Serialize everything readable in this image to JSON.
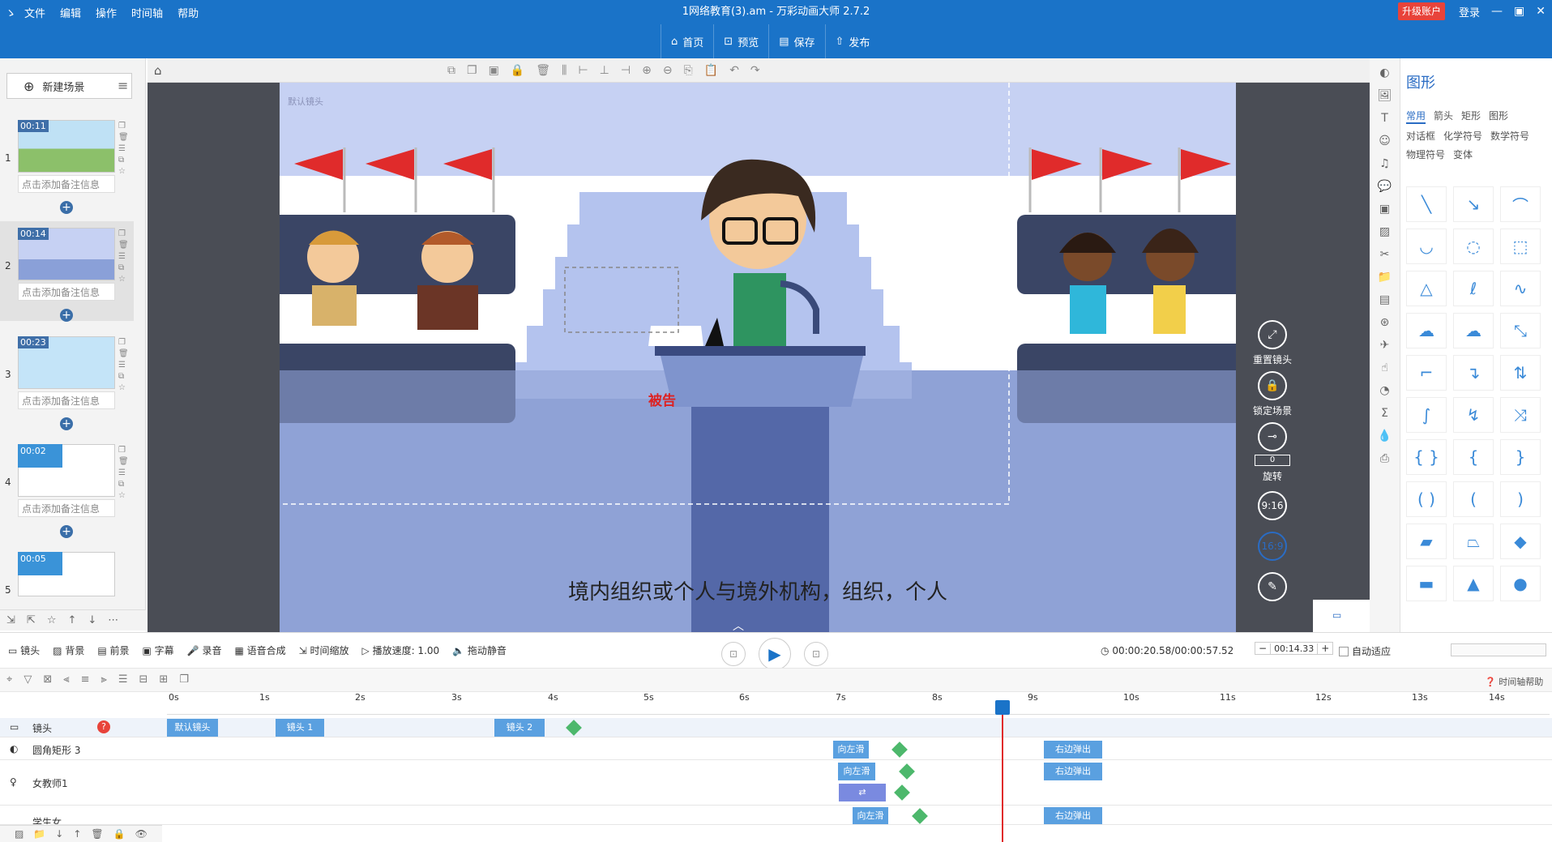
{
  "app": {
    "logo": "ゝ",
    "title": "1网络教育(3).am - 万彩动画大师 2.7.2",
    "upgrade": "升级账户",
    "login": "登录"
  },
  "menu": [
    "文件",
    "编辑",
    "操作",
    "时间轴",
    "帮助"
  ],
  "top_buttons": [
    {
      "label": "首页",
      "icon": "home-icon"
    },
    {
      "label": "预览",
      "icon": "preview-icon"
    },
    {
      "label": "保存",
      "icon": "save-icon"
    },
    {
      "label": "发布",
      "icon": "publish-icon"
    }
  ],
  "left": {
    "new_scene": "新建场景",
    "scenes": [
      {
        "num": "1",
        "time": "00:11",
        "note": "点击添加备注信息"
      },
      {
        "num": "2",
        "time": "00:14",
        "note": "点击添加备注信息"
      },
      {
        "num": "3",
        "time": "00:23",
        "note": "点击添加备注信息"
      },
      {
        "num": "4",
        "time": "00:02",
        "note": "点击添加备注信息"
      },
      {
        "num": "5",
        "time": "00:05",
        "note": ""
      }
    ]
  },
  "canvas": {
    "camera_label": "默认镜头",
    "podium_label": "被告",
    "subtitle": "境内组织或个人与境外机构，组织，个人"
  },
  "side_tools": {
    "reset": "重置镜头",
    "lock": "锁定场景",
    "rotate_value": "0",
    "rotate": "旋转",
    "ratio1": "9:16",
    "ratio2": "16:9"
  },
  "right": {
    "title": "图形",
    "tabs": [
      "常用",
      "箭头",
      "矩形",
      "图形",
      "对话框",
      "化学符号",
      "数学符号",
      "物理符号",
      "变体"
    ]
  },
  "playbar": {
    "items": [
      "镜头",
      "背景",
      "前景",
      "字幕",
      "录音",
      "语音合成",
      "时间缩放",
      "播放速度: 1.00",
      "拖动静音"
    ],
    "time": "00:00:20.58/00:00:57.52",
    "current": "00:14.33",
    "auto": "自动适应",
    "help": "时间轴帮助"
  },
  "timeline": {
    "ticks": [
      "0s",
      "1s",
      "2s",
      "3s",
      "4s",
      "5s",
      "6s",
      "7s",
      "8s",
      "9s",
      "10s",
      "11s",
      "12s",
      "13s",
      "14s"
    ],
    "rows": [
      {
        "name": "镜头"
      },
      {
        "name": "圆角矩形 3"
      },
      {
        "name": "女教师1"
      },
      {
        "name": "学生女"
      }
    ],
    "camera": [
      "默认镜头",
      "镜头 1",
      "镜头 2"
    ],
    "anim_left": "向左滑",
    "anim_right": "右边弹出"
  }
}
